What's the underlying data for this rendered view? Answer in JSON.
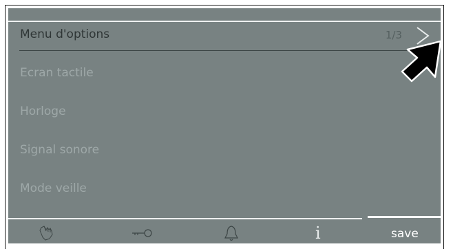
{
  "header": {
    "title": "Menu d'options",
    "page_indicator": "1/3"
  },
  "menu": {
    "items": [
      {
        "label": "Ecran tactile"
      },
      {
        "label": "Horloge"
      },
      {
        "label": "Signal sonore"
      },
      {
        "label": "Mode veille"
      }
    ]
  },
  "toolbar": {
    "icons": [
      "hand-icon",
      "key-icon",
      "bell-icon",
      "info-icon"
    ],
    "info_glyph": "i",
    "save_label": "save"
  },
  "colors": {
    "screen_bg": "#788282",
    "text_dim": "#9ea8a8",
    "title_text": "#2f3636",
    "highlight_line": "#eef0f0"
  }
}
